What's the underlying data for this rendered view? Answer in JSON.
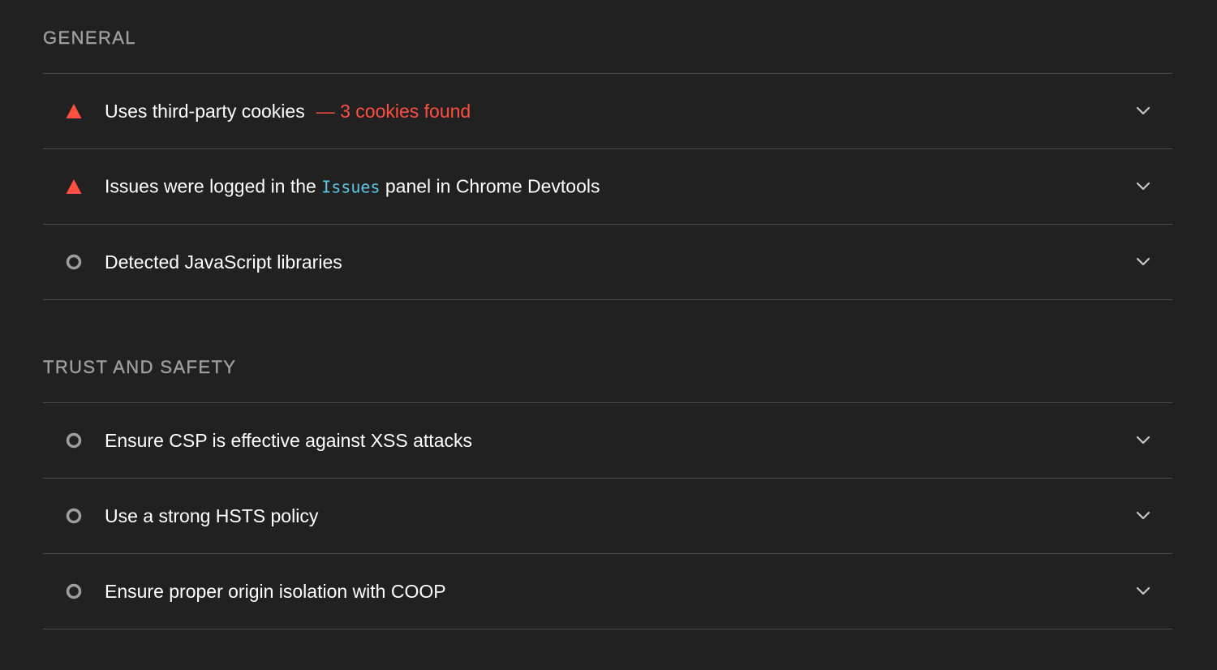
{
  "colors": {
    "background": "#212121",
    "fail": "#ff4e42",
    "neutral": "#9e9e9e",
    "code": "#5fc3e4",
    "divider": "#4a4a4a"
  },
  "sections": [
    {
      "title": "GENERAL",
      "audits": [
        {
          "status": "fail",
          "icon": "warning-triangle-icon",
          "text_before": "Uses third-party cookies",
          "display_value": "— 3 cookies found"
        },
        {
          "status": "fail",
          "icon": "warning-triangle-icon",
          "text_before": "Issues were logged in the ",
          "code": "Issues",
          "text_after": " panel in Chrome Devtools"
        },
        {
          "status": "informative",
          "icon": "circle-icon",
          "text_before": "Detected JavaScript libraries"
        }
      ]
    },
    {
      "title": "TRUST AND SAFETY",
      "audits": [
        {
          "status": "informative",
          "icon": "circle-icon",
          "text_before": "Ensure CSP is effective against XSS attacks"
        },
        {
          "status": "informative",
          "icon": "circle-icon",
          "text_before": "Use a strong HSTS policy"
        },
        {
          "status": "informative",
          "icon": "circle-icon",
          "text_before": "Ensure proper origin isolation with COOP"
        }
      ]
    }
  ]
}
